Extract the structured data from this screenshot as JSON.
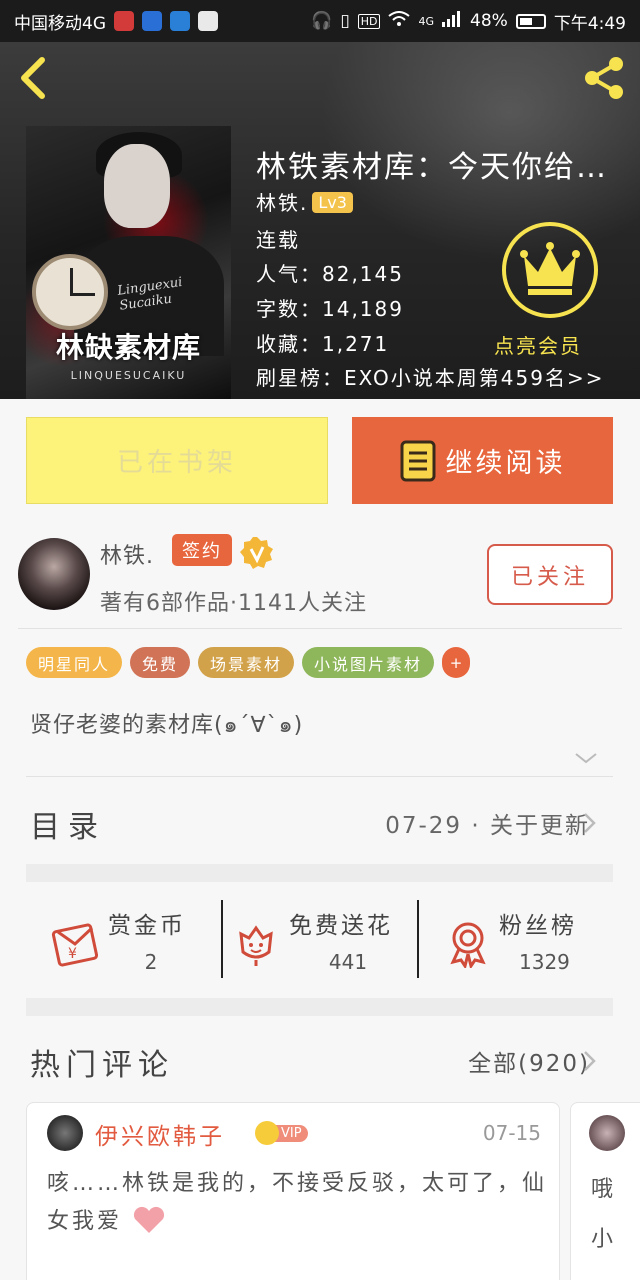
{
  "status_bar": {
    "carrier": "中国移动4G",
    "time": "下午4:49",
    "battery": "48%",
    "hd": "HD",
    "network": "4G"
  },
  "book": {
    "title": "林铁素材库：今天你给…",
    "author": "林铁.",
    "level": "Lv3",
    "status": "连载",
    "popularity": "人气：82,145",
    "word_count": "字数：14,189",
    "favorites": "收藏：1,271",
    "ranking": "刷星榜：EXO小说本周第459名>>",
    "cover_title": "林缺素材库",
    "cover_script": "Linguexui Sucaiku",
    "cover_subtitle": "LINQUESUCAIKU"
  },
  "vip": {
    "label": "点亮会员"
  },
  "actions": {
    "shelf_label": "已在书架",
    "read_label": "继续阅读"
  },
  "author": {
    "name": "林铁.",
    "signed": "签约",
    "stats": "著有6部作品·1141人关注",
    "follow_label": "已关注"
  },
  "tags": [
    {
      "label": "明星同人",
      "color": "#f4b64a"
    },
    {
      "label": "免费",
      "color": "#d07356"
    },
    {
      "label": "场景素材",
      "color": "#d2a24a"
    },
    {
      "label": "小说图片素材",
      "color": "#8eb65a"
    }
  ],
  "tag_more": "+",
  "description": "贤仔老婆的素材库(๑´∀`๑)",
  "toc": {
    "label": "目录",
    "latest": "07-29 · 关于更新"
  },
  "stats": [
    {
      "title": "赏金币",
      "value": "2"
    },
    {
      "title": "免费送花",
      "value": "441"
    },
    {
      "title": "粉丝榜",
      "value": "1329"
    }
  ],
  "comments": {
    "title": "热门评论",
    "all": "全部(920)",
    "items": [
      {
        "name": "伊兴欧韩子",
        "vip": "VIP",
        "date": "07-15",
        "text": "咳……林铁是我的，不接受反驳，太可了，仙女我爱"
      },
      {
        "text_line1": "哦",
        "text_line2": "小"
      }
    ]
  },
  "colors": {
    "accent": "#e8663d",
    "shelf_button": "#fdf27a",
    "vip_gold": "#f7e34f"
  }
}
